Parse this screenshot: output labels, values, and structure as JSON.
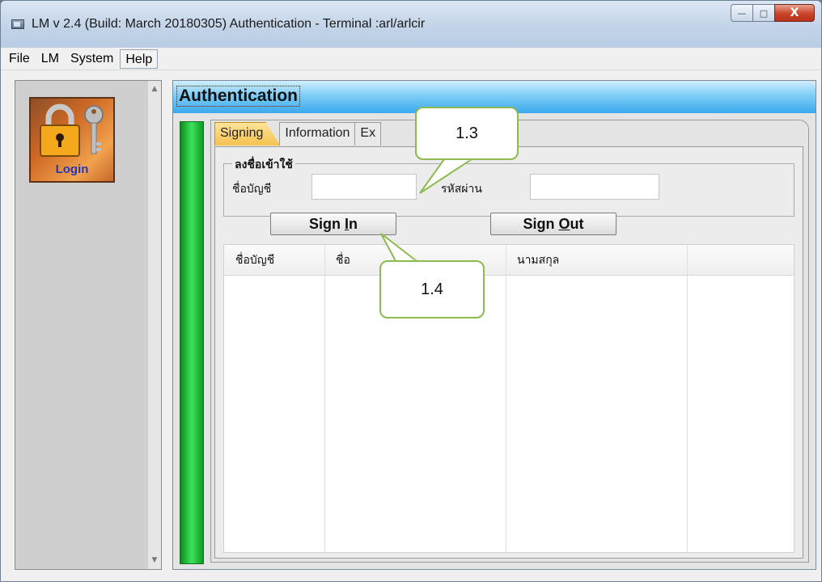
{
  "window": {
    "title": "LM v 2.4 (Build: March 20180305) Authentication - Terminal :arl/arlcir",
    "controls": {
      "minimize": "—",
      "maximize": "□",
      "close": "X"
    }
  },
  "menu": [
    "File",
    "LM",
    "System",
    "Help"
  ],
  "sidebar": {
    "login_label": "Login"
  },
  "panel": {
    "title": "Authentication",
    "tabs": [
      "Signing",
      "Information",
      "Ex"
    ],
    "group_title": "ลงชื่อเข้าใช้",
    "account_label": "ชื่อบัญชี",
    "account_value": "",
    "password_label": "รหัสผ่าน",
    "password_value": "",
    "sign_in": {
      "pre": "Sign ",
      "key": "I",
      "post": "n"
    },
    "sign_out": {
      "pre": "Sign ",
      "key": "O",
      "post": "ut"
    },
    "table_headers": [
      "ชื่อบัญชี",
      "ชื่อ",
      "นามสกุล",
      ""
    ]
  },
  "callouts": {
    "c1": "1.3",
    "c2": "1.4"
  },
  "colors": {
    "header_gradient_end": "#3aa9ee",
    "active_tab": "#f6c24e",
    "callout_border": "#8dbb4f",
    "status_bar": "#3de35a"
  }
}
